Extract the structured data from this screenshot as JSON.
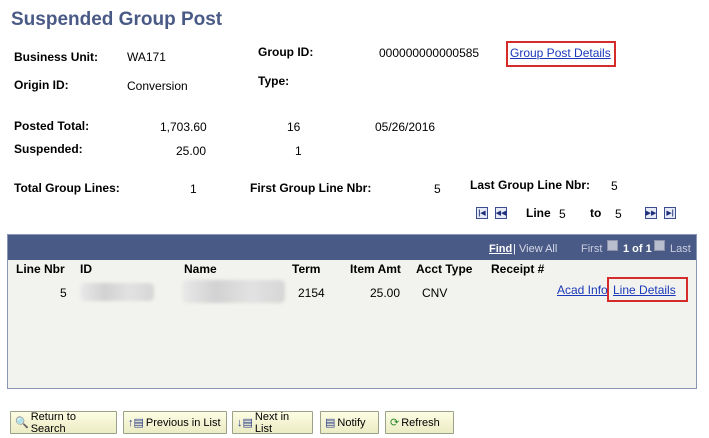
{
  "page": {
    "title": "Suspended Group Post"
  },
  "header": {
    "business_unit_label": "Business Unit:",
    "business_unit": "WA171",
    "group_id_label": "Group ID:",
    "group_id": "000000000000585",
    "group_post_details_link": "Group Post Details",
    "origin_id_label": "Origin ID:",
    "origin_id": "Conversion",
    "type_label": "Type:",
    "type_value": ""
  },
  "totals": {
    "posted_total_label": "Posted Total:",
    "posted_amount": "1,703.60",
    "posted_count": "16",
    "posted_date": "05/26/2016",
    "suspended_label": "Suspended:",
    "suspended_amount": "25.00",
    "suspended_count": "1"
  },
  "lines_info": {
    "total_group_lines_label": "Total Group Lines:",
    "total_group_lines": "1",
    "first_line_label": "First Group Line Nbr:",
    "first_line": "5",
    "last_line_label": "Last Group Line Nbr:",
    "last_line": "5",
    "line_label": "Line",
    "line_from": "5",
    "to_label": "to",
    "line_to": "5"
  },
  "grid": {
    "find_label": "Find",
    "separator": "|",
    "view_all_label": "View All",
    "first_label": "First",
    "pager_text": "1 of 1",
    "last_label": "Last",
    "columns": [
      "Line Nbr",
      "ID",
      "Name",
      "Term",
      "Item Amt",
      "Acct Type",
      "Receipt #"
    ],
    "rows": [
      {
        "line_nbr": "5",
        "term": "2154",
        "item_amt": "25.00",
        "acct_type": "CNV",
        "receipt": "",
        "acad_info_link": "Acad Info",
        "line_details_link": "Line Details"
      }
    ]
  },
  "toolbar": {
    "return_to_search": "Return to Search",
    "previous_in_list": "Previous in List",
    "next_in_list": "Next in List",
    "notify": "Notify",
    "refresh": "Refresh"
  },
  "colors": {
    "title": "#4a5a86",
    "grid_header": "#4a5a86",
    "link": "#1a38b9",
    "highlight": "#d62b2b"
  }
}
